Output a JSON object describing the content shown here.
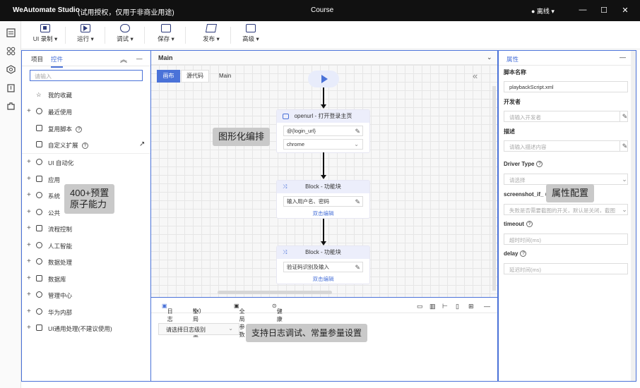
{
  "titlebar": {
    "app_name": "WeAutomate Studio",
    "license_note": "(试用授权，仅用于非商业用途)",
    "document": "Course",
    "status": "● 离线 ▾",
    "minimize": "—",
    "maximize": "☐",
    "close": "✕"
  },
  "toolbar": {
    "items": [
      {
        "label": "UI 录制 ▾"
      },
      {
        "label": "运行 ▾"
      },
      {
        "label": "调试 ▾"
      },
      {
        "label": "保存 ▾"
      },
      {
        "label": "发布 ▾"
      },
      {
        "label": "高级 ▾"
      }
    ]
  },
  "left_panel": {
    "tabs": [
      "项目",
      "控件"
    ],
    "search_placeholder": "请输入",
    "collapse": "︽",
    "minimize": "—",
    "top_items": [
      {
        "label": "我的收藏"
      },
      {
        "label": "最近使用"
      },
      {
        "label": "复用脚本"
      },
      {
        "label": "自定义扩展"
      }
    ],
    "categories": [
      {
        "label": "UI 自动化"
      },
      {
        "label": "应用"
      },
      {
        "label": "系统"
      },
      {
        "label": "公共"
      },
      {
        "label": "流程控制"
      },
      {
        "label": "人工智能"
      },
      {
        "label": "数据处理"
      },
      {
        "label": "数据库"
      },
      {
        "label": "管理中心"
      },
      {
        "label": "华为内部"
      },
      {
        "label": "UI通用处理(不建议使用)"
      }
    ],
    "overlay": "400+预置\n原子能力"
  },
  "canvas": {
    "tab": "Main",
    "view_tabs": [
      "画布",
      "源代码"
    ],
    "breadcrumb": "Main",
    "collapse_icon": "«",
    "overlay": "图形化编排",
    "nodes": [
      {
        "title": "openurl - 打开登录主页",
        "fields": [
          "@{login_url}",
          "chrome"
        ]
      },
      {
        "title": "Block - 功能块",
        "fields": [
          "输入用户名、密码"
        ],
        "link": "双击编辑"
      },
      {
        "title": "Block - 功能块",
        "fields": [
          "验证码识别及输入"
        ],
        "link": "双击编辑"
      }
    ]
  },
  "log_panel": {
    "tabs": [
      "日志",
      "全局变量",
      "全局参数",
      "健康检查"
    ],
    "tab_prefixes": [
      "",
      "f(x)",
      "",
      ""
    ],
    "level_select": "请选择日志级别",
    "overlay": "支持日志调试、常量参量设置"
  },
  "right_panel": {
    "title": "属性",
    "minimize": "—",
    "overlay": "属性配置",
    "fields": [
      {
        "label": "脚本名称",
        "value": "playbackScript.xml",
        "placeholder": ""
      },
      {
        "label": "开发者",
        "value": "",
        "placeholder": "请输入开发者"
      },
      {
        "label": "描述",
        "value": "",
        "placeholder": "请输入描述内容"
      },
      {
        "label": "Driver Type",
        "value": "",
        "placeholder": "请选择"
      },
      {
        "label": "screenshot_if_",
        "value": "",
        "placeholder": "失败是否需要截图的开关，默认是关闭，截图"
      },
      {
        "label": "timeout",
        "value": "",
        "placeholder": "超时时间(ms)"
      },
      {
        "label": "delay",
        "value": "",
        "placeholder": "延迟时间(ms)"
      }
    ]
  },
  "colors": {
    "accent": "#4a72d8",
    "titlebar": "#111111",
    "overlay_bg": "#c9c9c9"
  }
}
